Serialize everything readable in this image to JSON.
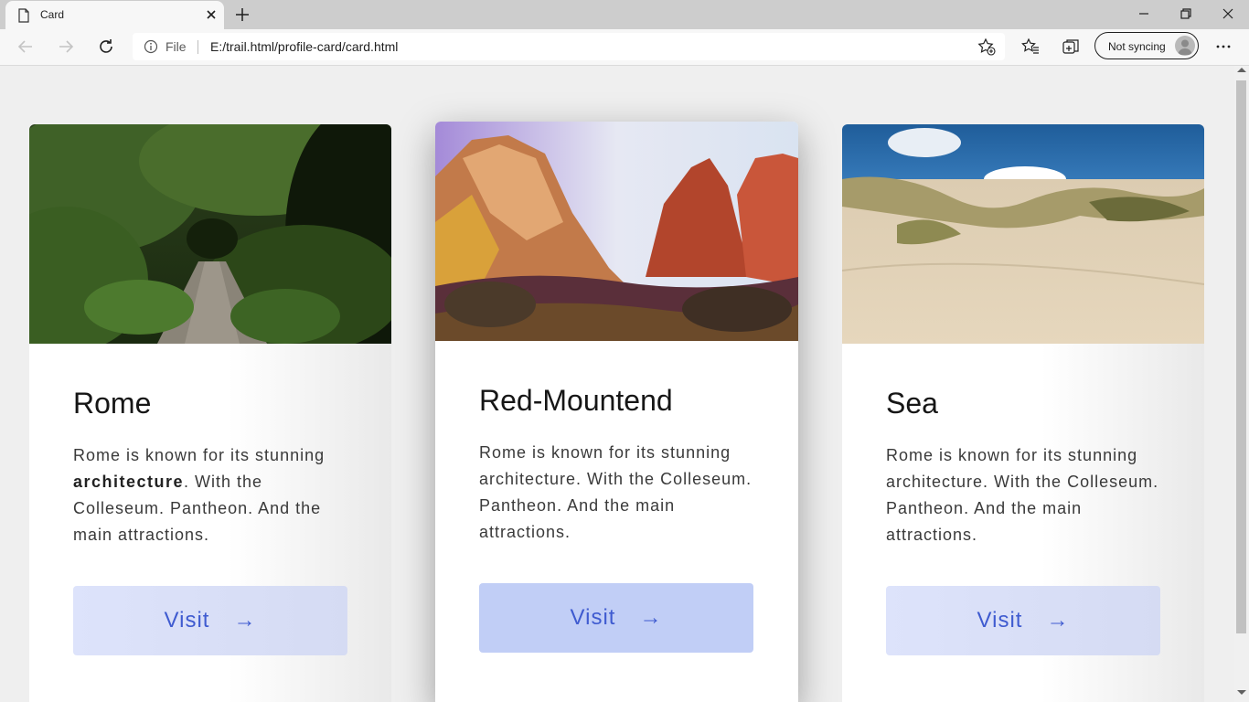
{
  "browser": {
    "tab_title": "Card",
    "address": {
      "scheme_label": "File",
      "url": "E:/trail.html/profile-card/card.html"
    },
    "profile_button_label": "Not syncing",
    "icons": [
      "file-icon",
      "close-icon",
      "plus-icon",
      "back-icon",
      "forward-icon",
      "refresh-icon",
      "info-icon",
      "add-favorite-icon",
      "favorites-icon",
      "collections-icon",
      "more-icon",
      "minimize-icon",
      "restore-icon",
      "window-close-icon"
    ]
  },
  "cards": [
    {
      "title": "Rome",
      "text_before": "Rome is known for its stunning ",
      "text_bold": "architecture",
      "text_after": ". With the Colleseum. Pantheon. And the main attractions.",
      "button_label": "Visit",
      "arrow": "→",
      "image": "forest-path-photo"
    },
    {
      "title": "Red-Mountend",
      "text": "Rome is known for its stunning architecture. With the Colleseum. Pantheon. And the main attractions.",
      "button_label": "Visit",
      "arrow": "→",
      "image": "red-canyon-photo"
    },
    {
      "title": "Sea",
      "text": "Rome is known for its stunning architecture. With the Colleseum. Pantheon. And the main attractions.",
      "button_label": "Visit",
      "arrow": "→",
      "image": "sand-dunes-photo"
    }
  ],
  "colors": {
    "page_bg": "#efefef",
    "button_bg": "#dde3fb",
    "button_bg_active": "#c1cef6",
    "button_text": "#3f5bd0"
  }
}
